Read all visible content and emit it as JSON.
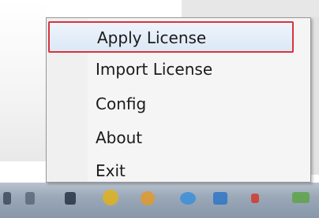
{
  "menu": {
    "items": [
      {
        "label": "Apply License",
        "selected": true
      },
      {
        "label": "Import License"
      },
      {
        "label": "Config"
      },
      {
        "label": "About"
      },
      {
        "label": "Exit"
      }
    ]
  },
  "taskbar": {
    "tray_icons": [
      "tray-app-icon-1",
      "tray-app-icon-2",
      "tray-app-icon-3",
      "tray-app-icon-4",
      "tray-app-icon-5",
      "tray-app-icon-6",
      "tray-app-icon-7",
      "tray-app-icon-8",
      "tray-app-icon-9"
    ]
  },
  "colors": {
    "highlight_border": "#d8333a",
    "menu_bg": "#f5f5f5",
    "taskbar": "#9aa8b8"
  }
}
